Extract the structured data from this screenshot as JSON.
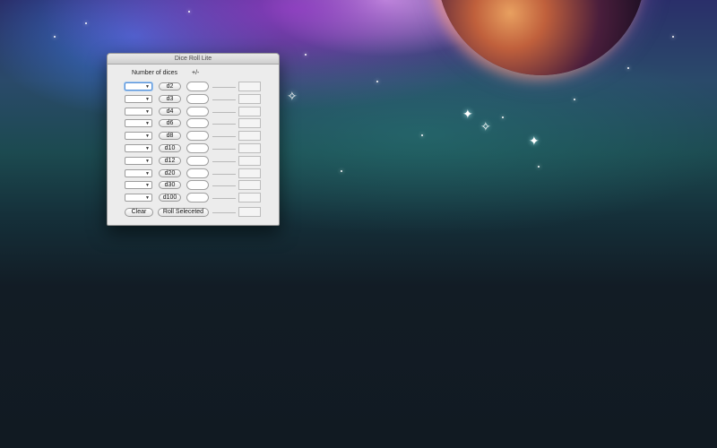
{
  "window": {
    "title": "Dice Roll Lite",
    "headers": {
      "count": "Number of dices",
      "modifier": "+/-"
    },
    "rows": [
      {
        "die": "d2"
      },
      {
        "die": "d3"
      },
      {
        "die": "d4"
      },
      {
        "die": "d6"
      },
      {
        "die": "d8"
      },
      {
        "die": "d10"
      },
      {
        "die": "d12"
      },
      {
        "die": "d20"
      },
      {
        "die": "d30"
      },
      {
        "die": "d100"
      }
    ],
    "clear_label": "Clear",
    "roll_label": "Roll Seleceted"
  },
  "icons": {
    "dropdown": "chevron-down-icon"
  },
  "colors": {
    "window_bg": "#ececec",
    "focus": "#5b94d8"
  }
}
